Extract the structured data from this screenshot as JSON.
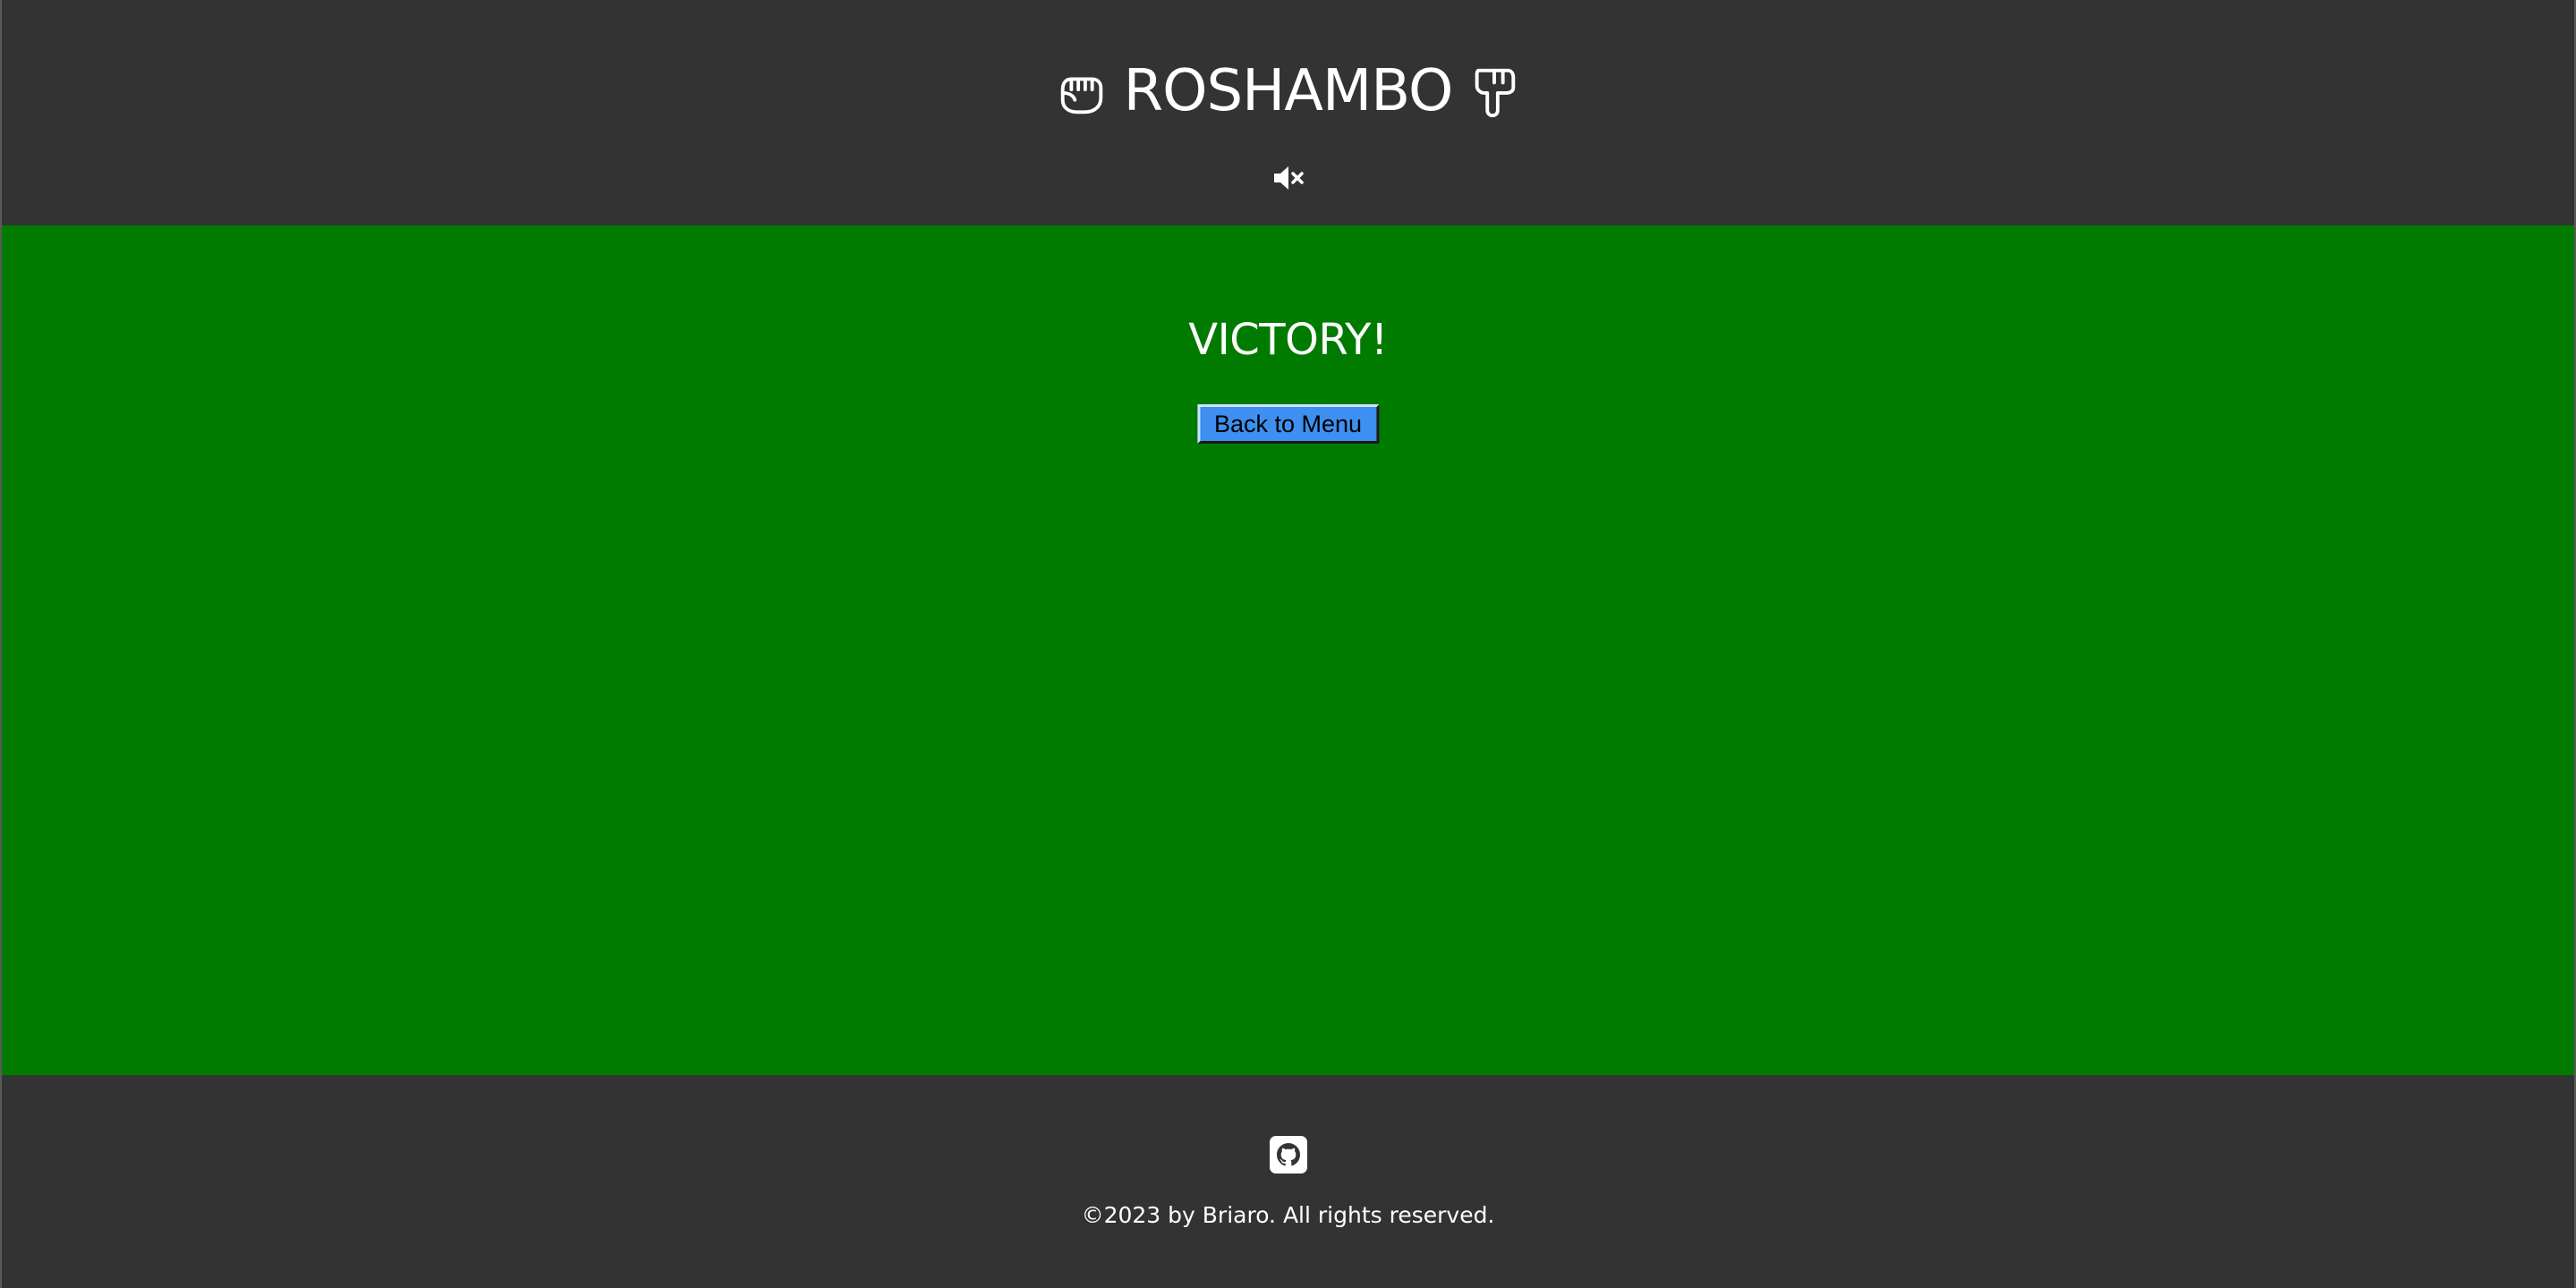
{
  "header": {
    "title": "ROSHAMBO",
    "left_icon": "raised-fist-icon",
    "right_icon": "hand-pointing-down-icon",
    "mute_icon": "speaker-muted-icon"
  },
  "main": {
    "result": "VICTORY!",
    "back_button_label": "Back to Menu",
    "background_color": "#007b00",
    "button_color": "#3e8ff0"
  },
  "footer": {
    "github_icon": "github-icon",
    "copyright": "©2023 by Briaro. All rights reserved."
  }
}
